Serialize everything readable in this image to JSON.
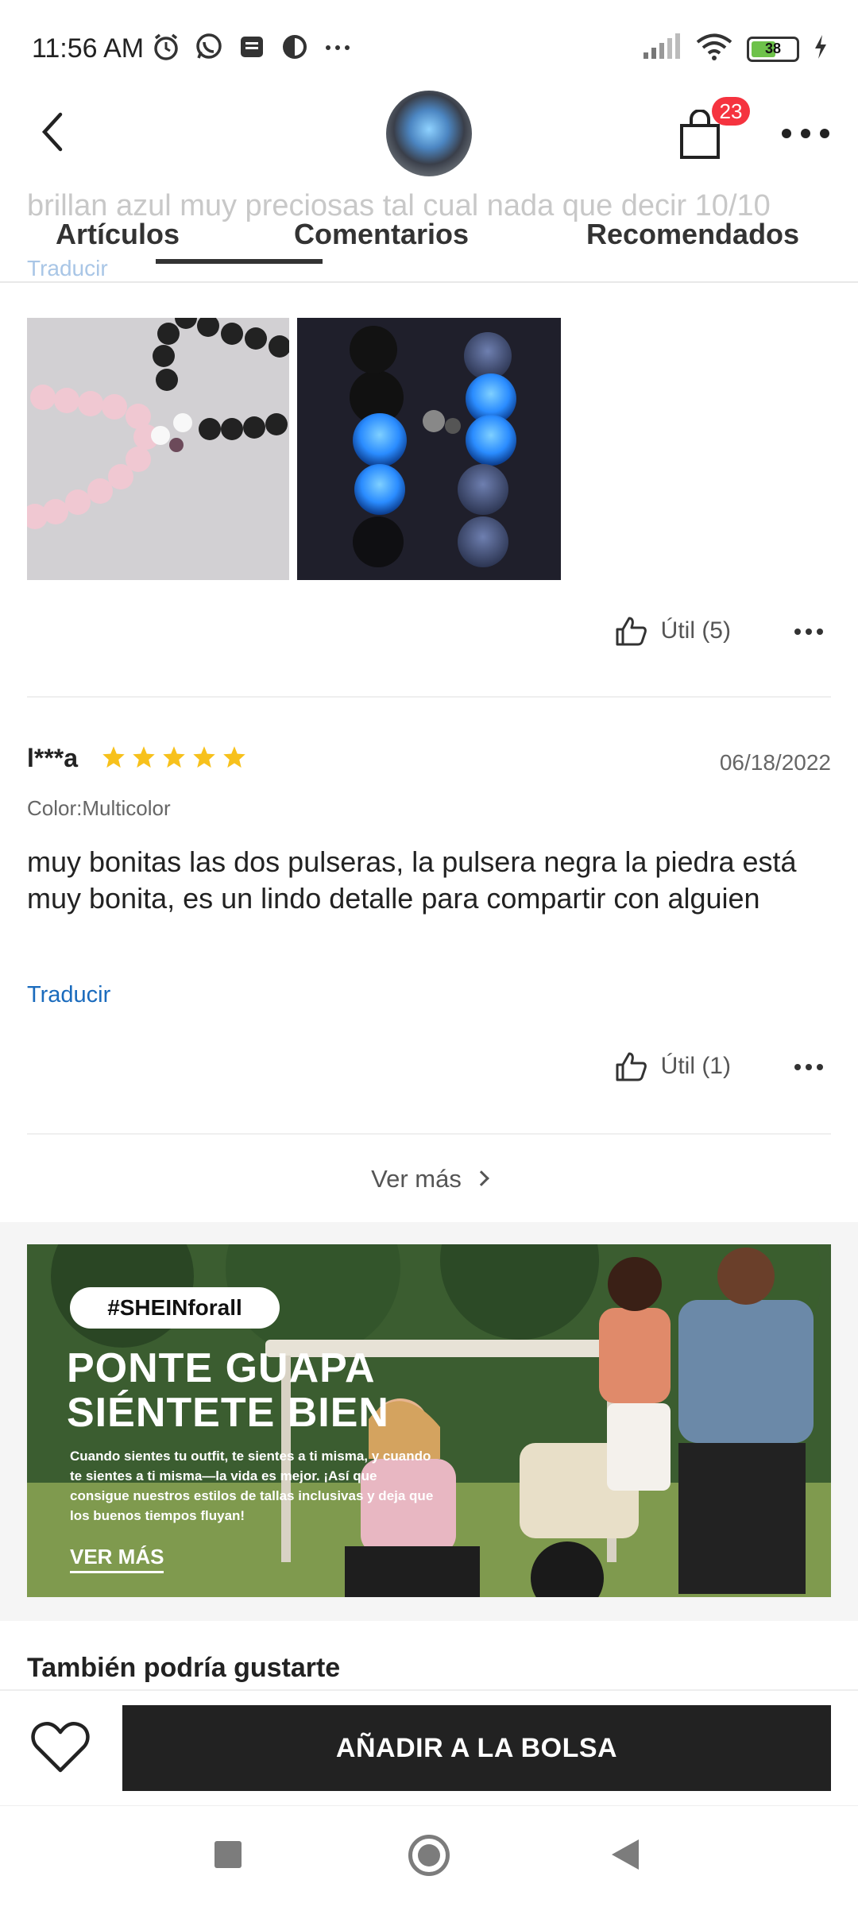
{
  "status_bar": {
    "time": "11:56 AM",
    "battery_level": "38",
    "icons": [
      "alarm-icon",
      "whatsapp-icon",
      "message-icon",
      "app-icon",
      "more-dots-icon",
      "signal-icon",
      "wifi-icon",
      "battery-icon",
      "charging-icon"
    ]
  },
  "header": {
    "cart_count": "23"
  },
  "tabs": {
    "items": [
      "Artículos",
      "Comentarios",
      "Recomendados"
    ],
    "active_index": 1
  },
  "previous_review": {
    "text_partial": "brillan azul muy preciosas tal cual nada que decir 10/10",
    "translate_label": "Traducir",
    "helpful_label": "Útil (5)"
  },
  "review": {
    "reviewer": "l***a",
    "rating": 5,
    "date": "06/18/2022",
    "color_label": "Color:Multicolor",
    "text": "muy bonitas las dos pulseras, la pulsera negra la piedra está muy bonita, es un lindo detalle para compartir con alguien",
    "translate_label": "Traducir",
    "helpful_label": "Útil (1)"
  },
  "see_more_label": "Ver más",
  "banner": {
    "tag": "#SHEINforall",
    "headline_1": "PONTE GUAPA",
    "headline_2": "SIÉNTETE BIEN",
    "body": "Cuando sientes tu outfit, te sientes a ti misma, y cuando te sientes a ti misma—la vida es mejor. ¡Así que consigue nuestros estilos de tallas inclusivas y deja que los buenos tiempos fluyan!",
    "cta": "VER MÁS"
  },
  "section_title": "También podría gustarte",
  "actions": {
    "add_to_bag": "AÑADIR A LA BOLSA"
  },
  "colors": {
    "accent_link": "#1a6bbd",
    "badge": "#f5333f",
    "star": "#f7c11c",
    "primary_button": "#222222"
  }
}
